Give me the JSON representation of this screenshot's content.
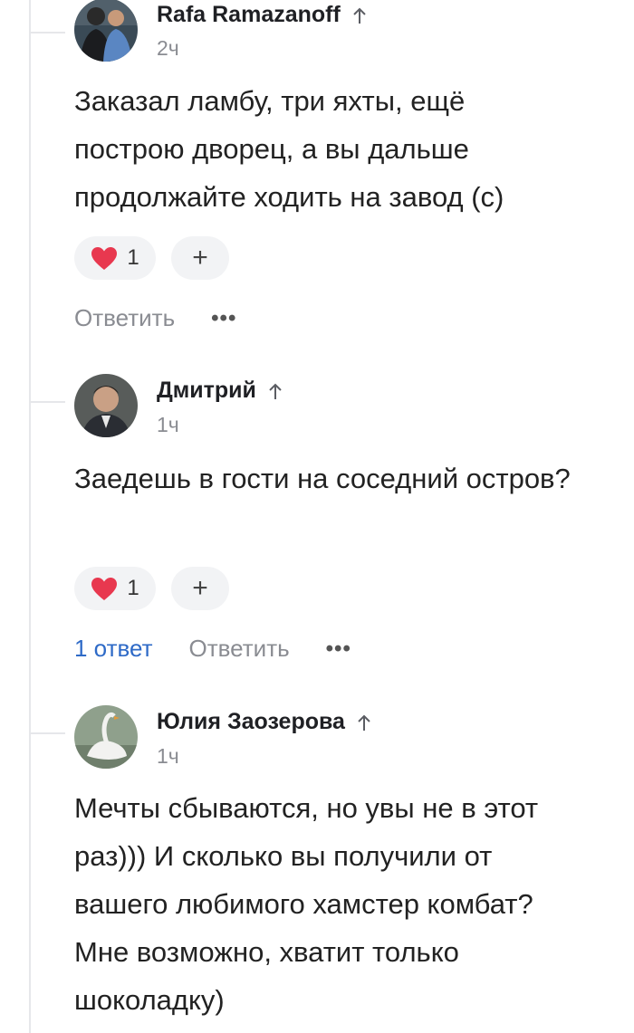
{
  "comments": [
    {
      "author": "Rafa Ramazanoff",
      "time": "2ч",
      "text": "Заказал ламбу, три яхты, ещё построю дворец, а вы дальше продолжайте ходить на завод (с)",
      "likes": "1",
      "plus_label": "+",
      "replies_label": "",
      "reply_label": "Ответить",
      "more_label": "•••"
    },
    {
      "author": "Дмитрий",
      "time": "1ч",
      "text": "Заедешь в гости на соседний остров?",
      "likes": "1",
      "plus_label": "+",
      "replies_label": "1 ответ",
      "reply_label": "Ответить",
      "more_label": "•••"
    },
    {
      "author": "Юлия Заозерова",
      "time": "1ч",
      "text": "Мечты сбываются, но увы не в этот раз))) И сколько вы получили от вашего любимого хамстер комбат? Мне возможно, хватит только шоколадку)"
    }
  ],
  "colors": {
    "accent": "#2e6ac7",
    "heart": "#e8384f",
    "muted": "#8a8c92",
    "pill": "#f2f3f5"
  },
  "icons": {
    "upvote": "arrow-up-icon",
    "like": "heart-icon",
    "more": "more-dots-icon"
  }
}
